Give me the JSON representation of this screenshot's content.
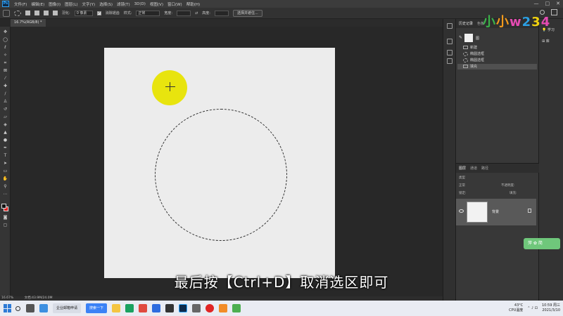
{
  "menu": {
    "app_icon": "Ps",
    "items": [
      "文件(F)",
      "编辑(E)",
      "图像(I)",
      "图层(L)",
      "文字(Y)",
      "选择(S)",
      "滤镜(T)",
      "3D(D)",
      "视图(V)",
      "窗口(W)",
      "帮助(H)"
    ],
    "window_controls": [
      "—",
      "□",
      "✕"
    ]
  },
  "options": {
    "feather_label": "羽化:",
    "feather_value": "0 像素",
    "antialias_label": "消除锯齿",
    "antialias_checked": true,
    "style_label": "样式:",
    "style_value": "正常",
    "width_label": "宽度:",
    "height_label": "高度:",
    "select_mask_button": "选择并遮住..."
  },
  "document": {
    "tab_title": "16.7%(RGB/8) *",
    "zoom_status": "16.67%",
    "doc_status": "文档:43.9M/24.0M"
  },
  "subtitle": "最后按【Ctrl+D】取消选区即可",
  "history": {
    "tabs": [
      "历史记录",
      "色板"
    ],
    "snapshot_label": "图",
    "steps": [
      {
        "label": "新建",
        "icon": "new-doc-icon",
        "selected": false
      },
      {
        "label": "椭圆选框",
        "icon": "ellipse-marquee-icon",
        "selected": false
      },
      {
        "label": "椭圆选框",
        "icon": "ellipse-marquee-icon",
        "selected": false
      },
      {
        "label": "填充",
        "icon": "fill-icon",
        "selected": true
      }
    ]
  },
  "learn": {
    "learn_label": "学习",
    "library_label": "库"
  },
  "watermark": [
    "小",
    "小",
    "w",
    "2",
    "3",
    "4"
  ],
  "layers": {
    "tabs": [
      "图层",
      "通道",
      "路径"
    ],
    "kind_label": "类型",
    "blend_mode": "正常",
    "opacity_label": "不透明度:",
    "lock_label": "锁定:",
    "fill_label": "填充:",
    "layer_name": "背景"
  },
  "badge": "萍 ✿ 简",
  "taskbar": {
    "search_button": "搜索一下",
    "app_label": "企业邮箱申请",
    "weather_temp": "43°C",
    "weather_label": "CPU温度",
    "time": "10:59 周三",
    "date": "2021/3/10"
  },
  "colors": {
    "yellow_fill": "#e8e40e",
    "canvas_bg": "#ececec",
    "background_color": "#e41f1f",
    "foreground_color": "#111111"
  }
}
